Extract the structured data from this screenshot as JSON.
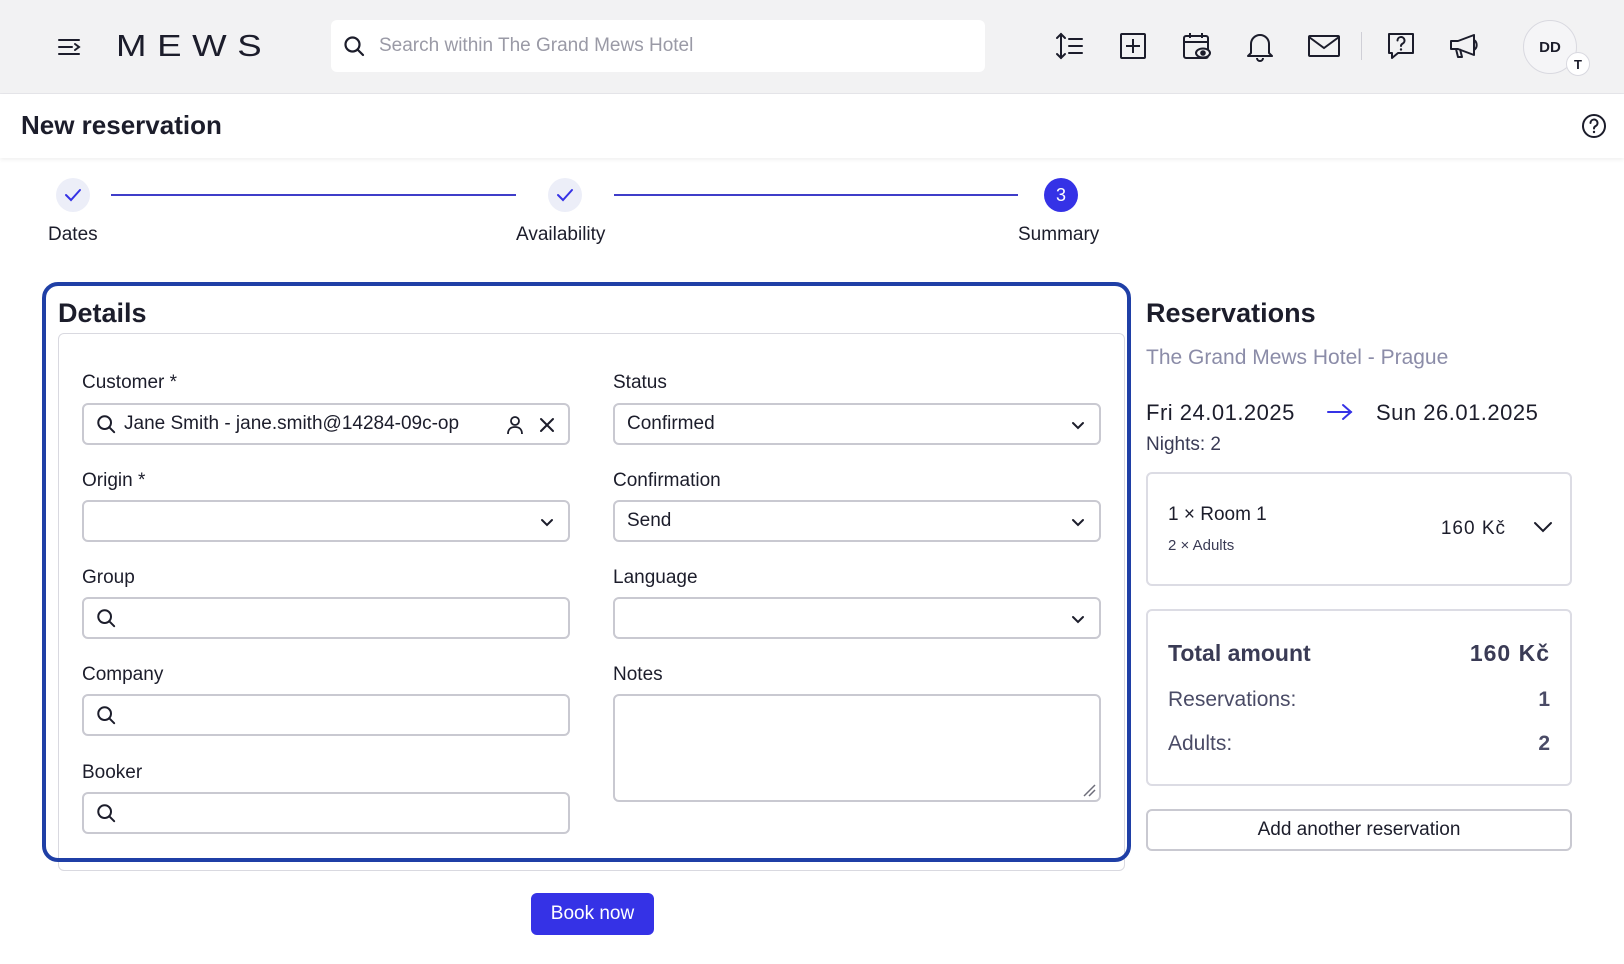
{
  "app": {
    "logo": "MEWS"
  },
  "search": {
    "placeholder": "Search within The Grand Mews Hotel"
  },
  "avatar": {
    "initials": "DD",
    "badge": "T"
  },
  "page": {
    "title": "New reservation"
  },
  "stepper": {
    "steps": [
      {
        "label": "Dates",
        "state": "done"
      },
      {
        "label": "Availability",
        "state": "done"
      },
      {
        "label": "Summary",
        "state": "active",
        "number": "3"
      }
    ]
  },
  "details": {
    "title": "Details",
    "customer": {
      "label": "Customer *",
      "value": "Jane Smith - jane.smith@14284-09c-op"
    },
    "origin": {
      "label": "Origin *",
      "value": ""
    },
    "group": {
      "label": "Group",
      "value": ""
    },
    "company": {
      "label": "Company",
      "value": ""
    },
    "booker": {
      "label": "Booker",
      "value": ""
    },
    "status": {
      "label": "Status",
      "value": "Confirmed"
    },
    "confirmation": {
      "label": "Confirmation",
      "value": "Send"
    },
    "language": {
      "label": "Language",
      "value": ""
    },
    "notes": {
      "label": "Notes",
      "value": ""
    },
    "book_label": "Book now"
  },
  "reservations": {
    "title": "Reservations",
    "hotel": "The Grand Mews Hotel - Prague",
    "start_date": "Fri 24.01.2025",
    "end_date": "Sun 26.01.2025",
    "nights": "Nights: 2",
    "room": {
      "name": "1 × Room 1",
      "guests": "2 × Adults",
      "price": "160 Kč"
    },
    "totals": {
      "label": "Total amount",
      "amount": "160 Kč",
      "reservations_label": "Reservations:",
      "reservations_value": "1",
      "adults_label": "Adults:",
      "adults_value": "2"
    },
    "add_label": "Add another reservation"
  },
  "colors": {
    "accent": "#3532e6",
    "focus_ring": "#1f3fa6",
    "topbar": "#f2f2f3",
    "muted": "#8b8ca8"
  }
}
